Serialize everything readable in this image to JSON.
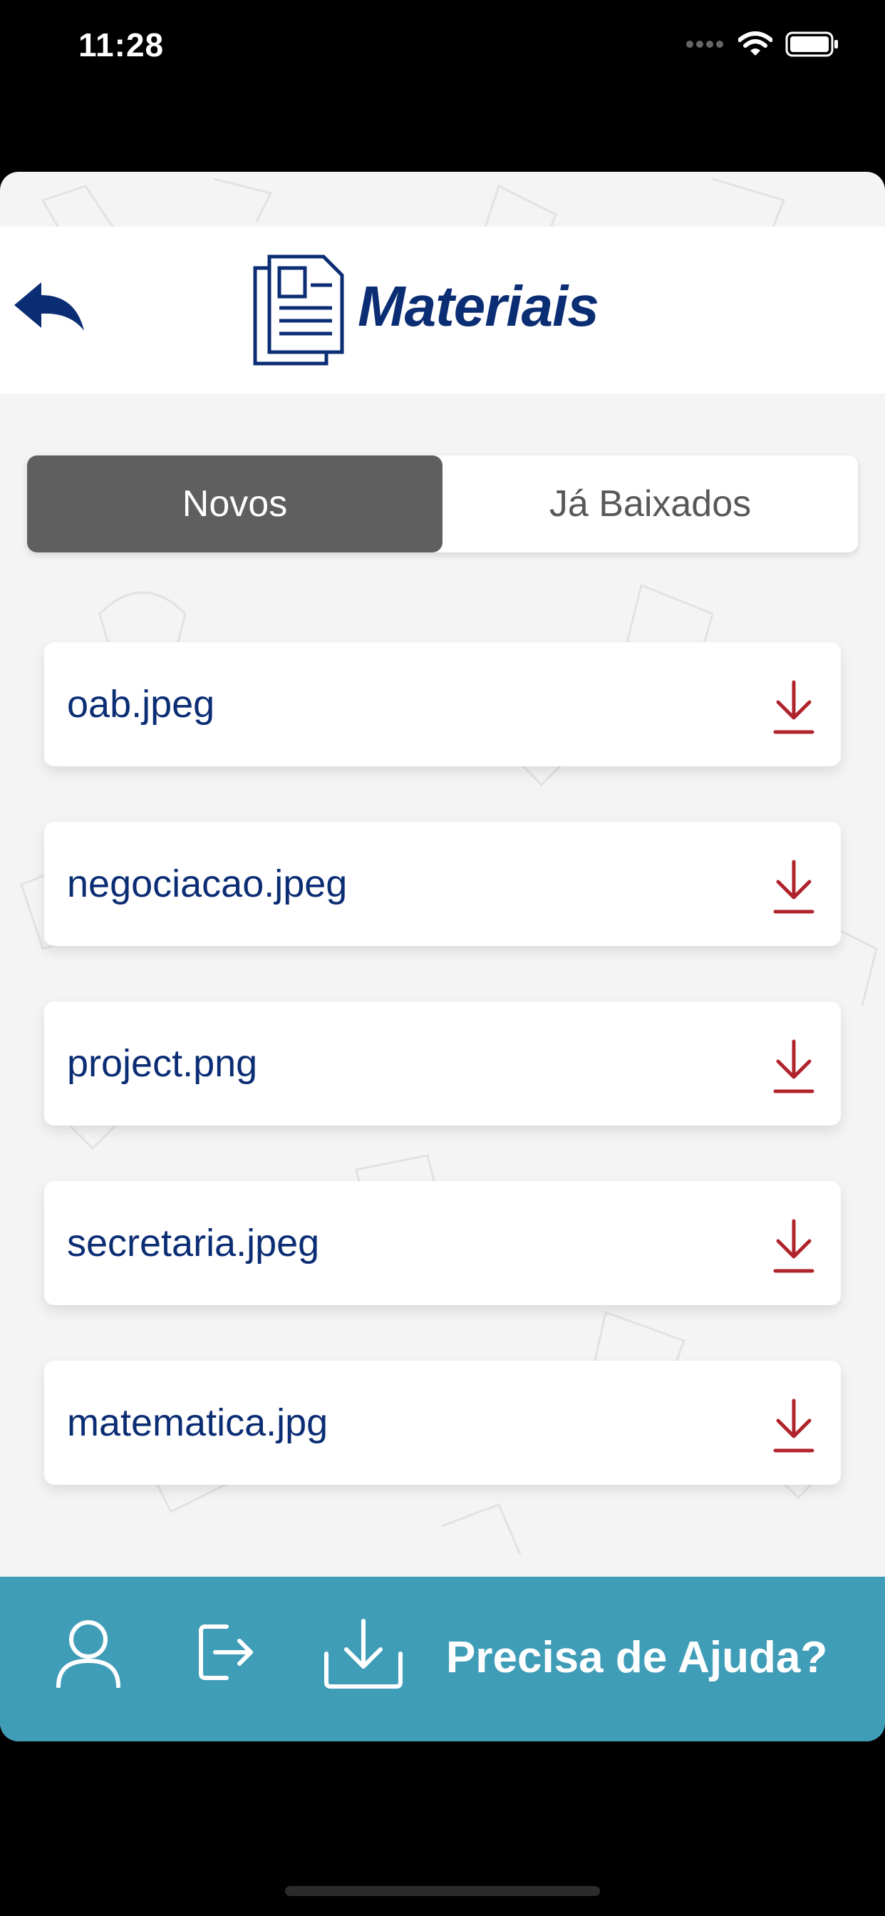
{
  "status_bar": {
    "time": "11:28"
  },
  "header": {
    "title": "Materiais"
  },
  "tabs": [
    {
      "label": "Novos",
      "active": true
    },
    {
      "label": "Já Baixados",
      "active": false
    }
  ],
  "files": [
    {
      "name": "oab.jpeg"
    },
    {
      "name": "negociacao.jpeg"
    },
    {
      "name": "project.png"
    },
    {
      "name": "secretaria.jpeg"
    },
    {
      "name": "matematica.jpg"
    }
  ],
  "bottom_bar": {
    "help_label": "Precisa de Ajuda?"
  },
  "colors": {
    "brand_navy": "#0b2d74",
    "download_red": "#b0232a",
    "bar_blue": "#409db8",
    "active_tab": "#5f5f5f"
  }
}
